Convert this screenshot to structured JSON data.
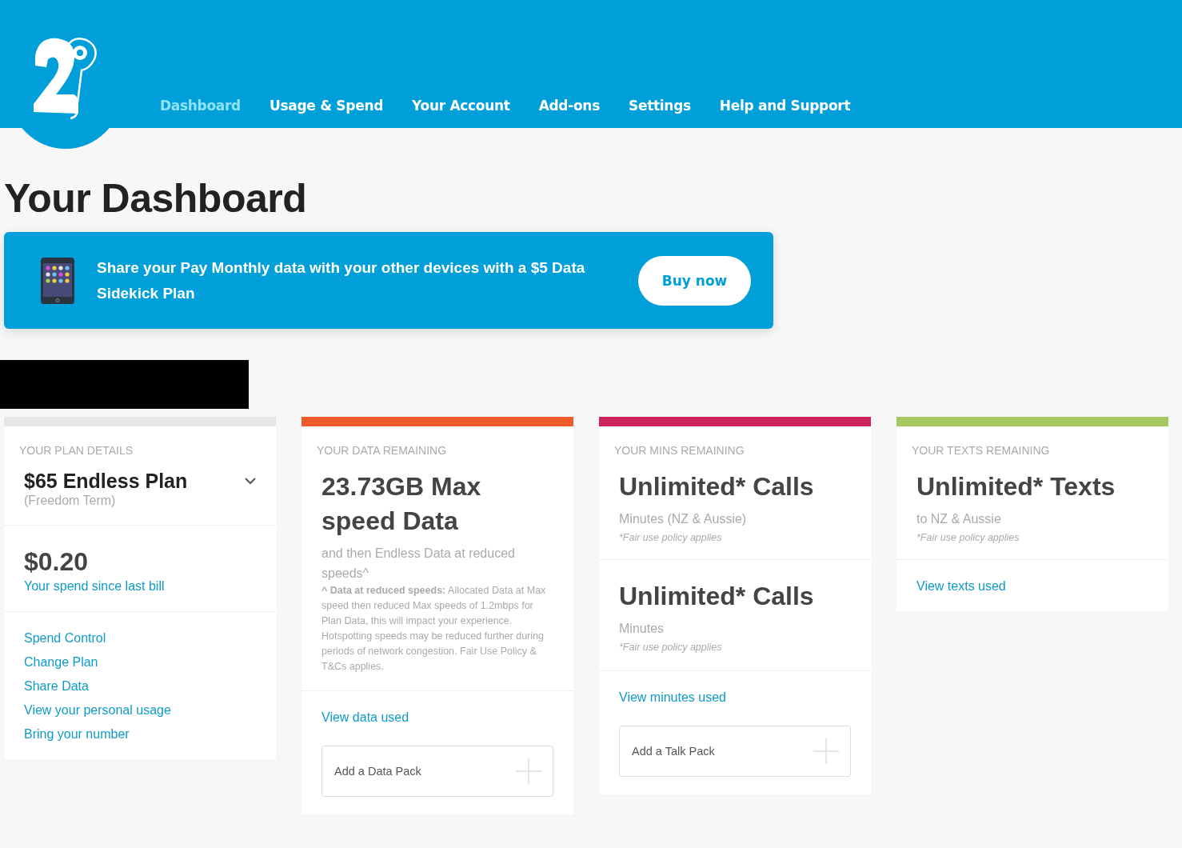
{
  "nav": [
    {
      "label": "Dashboard",
      "selected": true
    },
    {
      "label": "Usage & Spend",
      "selected": false
    },
    {
      "label": "Your Account",
      "selected": false
    },
    {
      "label": "Add-ons",
      "selected": false
    },
    {
      "label": "Settings",
      "selected": false
    },
    {
      "label": "Help and Support",
      "selected": false
    }
  ],
  "page_title": "Your Dashboard",
  "promo": {
    "text": "Share your Pay Monthly data with your other devices with a $5 Data Sidekick Plan",
    "button": "Buy now"
  },
  "cards": [
    {
      "title": "YOUR PLAN DETAILS",
      "color": "#e6e6e6",
      "sections": [
        {
          "kind": "plan",
          "name": "$65 Endless Plan",
          "term": "(Freedom Term)",
          "expanded": false
        },
        {
          "kind": "amount",
          "value": "$0.20",
          "link": "Your spend since last bill"
        },
        {
          "kind": "links",
          "items": [
            "Spend Control",
            "Change Plan",
            "Share Data",
            "View your personal usage",
            "Bring your number"
          ]
        }
      ]
    },
    {
      "title": "YOUR DATA REMAINING",
      "color": "#ef5b2b",
      "sections": [
        {
          "kind": "allowance",
          "headline": "23.73GB Max speed Data",
          "subtitle": "and then Endless Data at reduced speeds^",
          "footnote": "**^ Data at reduced speeds:** Allocated Data at Max speed then reduced Max speeds of 1.2mbps for Plan Data, this will impact your experience. Hotspotting speeds may be reduced further during periods of network congestion. Fair Use Policy & T&Cs applies."
        },
        {
          "kind": "action",
          "link": "View data used",
          "addon": "Add a Data Pack"
        }
      ]
    },
    {
      "title": "YOUR MINS REMAINING",
      "color": "#cf2360",
      "sections": [
        {
          "kind": "allowance",
          "headline": "Unlimited* Calls",
          "subtitle": "Minutes (NZ & Aussie)",
          "note": "*Fair use policy applies"
        },
        {
          "kind": "allowance",
          "headline": "Unlimited* Calls",
          "subtitle": "Minutes",
          "note": "*Fair use policy applies"
        },
        {
          "kind": "action",
          "link": "View minutes used",
          "addon": "Add a Talk Pack"
        }
      ]
    },
    {
      "title": "YOUR TEXTS REMAINING",
      "color": "#a5c861",
      "sections": [
        {
          "kind": "allowance",
          "headline": "Unlimited* Texts",
          "subtitle": "to NZ & Aussie",
          "note": "*Fair use policy applies"
        },
        {
          "kind": "action",
          "link": "View texts used"
        }
      ]
    }
  ]
}
